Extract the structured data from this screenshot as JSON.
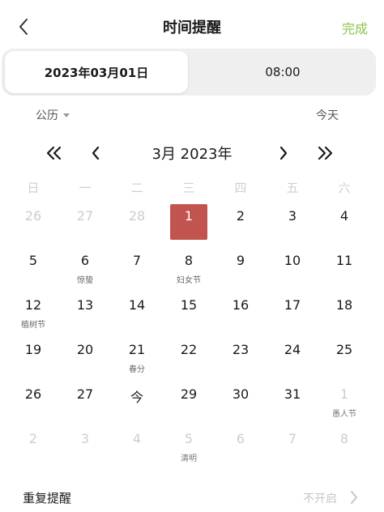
{
  "header": {
    "title": "时间提醒",
    "done_label": "完成"
  },
  "segment": {
    "date_label": "2023年03月01日",
    "time_label": "08:00"
  },
  "calendar_type": {
    "label": "公历"
  },
  "today_label": "今天",
  "month_nav": {
    "label": "3月 2023年"
  },
  "weekdays": [
    "日",
    "一",
    "二",
    "三",
    "四",
    "五",
    "六"
  ],
  "days": [
    {
      "n": "26",
      "dim": true
    },
    {
      "n": "27",
      "dim": true
    },
    {
      "n": "28",
      "dim": true
    },
    {
      "n": "1",
      "selected": true
    },
    {
      "n": "2"
    },
    {
      "n": "3"
    },
    {
      "n": "4"
    },
    {
      "n": "5"
    },
    {
      "n": "6",
      "sub": "惊蛰"
    },
    {
      "n": "7"
    },
    {
      "n": "8",
      "sub": "妇女节"
    },
    {
      "n": "9"
    },
    {
      "n": "10"
    },
    {
      "n": "11"
    },
    {
      "n": "12",
      "sub": "植树节"
    },
    {
      "n": "13"
    },
    {
      "n": "14"
    },
    {
      "n": "15"
    },
    {
      "n": "16"
    },
    {
      "n": "17"
    },
    {
      "n": "18"
    },
    {
      "n": "19"
    },
    {
      "n": "20"
    },
    {
      "n": "21",
      "sub": "春分"
    },
    {
      "n": "22"
    },
    {
      "n": "23"
    },
    {
      "n": "24"
    },
    {
      "n": "25"
    },
    {
      "n": "26"
    },
    {
      "n": "27"
    },
    {
      "n": "今"
    },
    {
      "n": "29"
    },
    {
      "n": "30"
    },
    {
      "n": "31"
    },
    {
      "n": "1",
      "dim": true,
      "sub": "愚人节"
    },
    {
      "n": "2",
      "dim": true
    },
    {
      "n": "3",
      "dim": true
    },
    {
      "n": "4",
      "dim": true
    },
    {
      "n": "5",
      "dim": true,
      "sub": "清明"
    },
    {
      "n": "6",
      "dim": true
    },
    {
      "n": "7",
      "dim": true
    },
    {
      "n": "8",
      "dim": true
    }
  ],
  "repeat": {
    "label": "重复提醒",
    "value": "不开启"
  },
  "colors": {
    "accent": "#8bc34a",
    "selected": "#c25450"
  }
}
